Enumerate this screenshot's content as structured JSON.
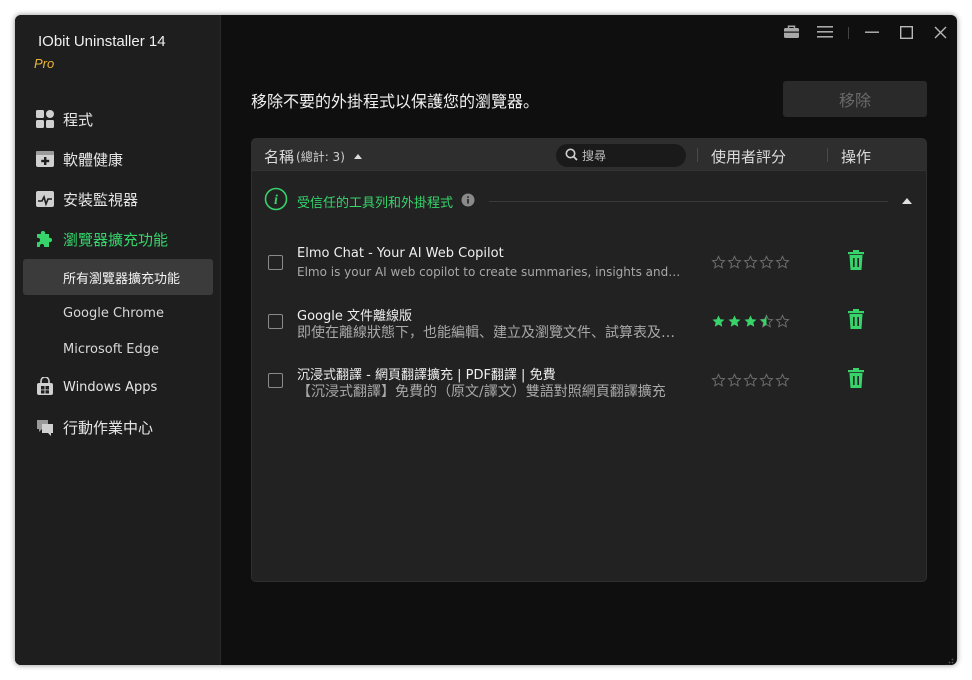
{
  "app": {
    "title": "IObit Uninstaller 14",
    "edition": "Pro"
  },
  "sidebar": {
    "items": [
      {
        "label": "程式",
        "icon": "programs-icon"
      },
      {
        "label": "軟體健康",
        "icon": "software-health-icon"
      },
      {
        "label": "安裝監視器",
        "icon": "install-monitor-icon"
      },
      {
        "label": "瀏覽器擴充功能",
        "icon": "puzzle-icon",
        "active": true
      },
      {
        "label": "Windows Apps",
        "icon": "windows-apps-icon"
      },
      {
        "label": "行動作業中心",
        "icon": "action-center-icon"
      }
    ],
    "subitems": [
      {
        "label": "所有瀏覽器擴充功能",
        "selected": true
      },
      {
        "label": "Google Chrome"
      },
      {
        "label": "Microsoft Edge"
      }
    ]
  },
  "main": {
    "heading": "移除不要的外掛程式以保護您的瀏覽器。",
    "remove_label": "移除",
    "table": {
      "name_header": "名稱",
      "count_label": "(總計: 3)",
      "search_placeholder": "搜尋",
      "rating_header": "使用者評分",
      "action_header": "操作"
    },
    "group": {
      "title": "受信任的工具列和外掛程式"
    },
    "rows": [
      {
        "name": "Elmo Chat - Your AI Web Copilot",
        "description": "Elmo is your AI web copilot to create summaries, insights and extended content",
        "rating": 0
      },
      {
        "name": "Google 文件離線版",
        "description": "即使在離線狀態下，也能編輯、建立及瀏覽文件、試算表及簡報",
        "rating": 3.5
      },
      {
        "name": "沉浸式翻譯 - 網頁翻譯擴充 | PDF翻譯 | 免費",
        "description": "【沉浸式翻譯】免費的（原文/譯文）雙語對照網頁翻譯擴充",
        "rating": 0
      }
    ]
  },
  "colors": {
    "accent": "#36d46b",
    "edition": "#e8b63a",
    "window_bg": "#0f0f0f",
    "sidebar_bg": "#1e1e1e",
    "panel_bg": "#222222"
  }
}
